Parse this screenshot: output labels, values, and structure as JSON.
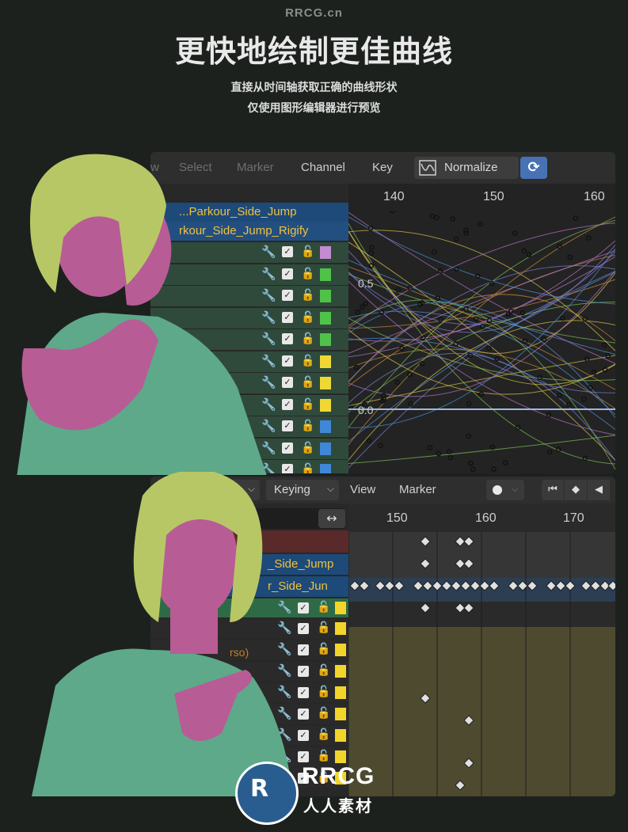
{
  "watermark_top": "RRCG.cn",
  "title": "更快地绘制更佳曲线",
  "subtitle_line1": "直接从时间轴获取正确的曲线形状",
  "subtitle_line2": "仅使用图形编辑器进行预览",
  "graph_editor": {
    "menus": [
      "w",
      "Select",
      "Marker",
      "Channel",
      "Key"
    ],
    "normalize_label": "Normalize",
    "ruler_frames": [
      "140",
      "150",
      "160"
    ],
    "y_labels": [
      "0.5",
      "0.0"
    ],
    "object_rows": [
      "...Parkour_Side_Jump",
      "rkour_Side_Jump_Rigify"
    ],
    "channel_colors": [
      "#c58bd0",
      "#4fc24a",
      "#4fc24a",
      "#4fc24a",
      "#4fc24a",
      "#f0d834",
      "#f0d834",
      "#f0d834",
      "#3f87d8",
      "#3f87d8",
      "#3f87d8"
    ]
  },
  "dope_sheet": {
    "keying_label": "Keying",
    "menus": [
      "View",
      "Marker"
    ],
    "ruler_frames": [
      "150",
      "160",
      "170"
    ],
    "object_rows": [
      "_Side_Jump",
      "r_Side_Jun"
    ],
    "torso_label": "rso)",
    "channel_color": "#f2d52a"
  },
  "logo": {
    "name": "RRCG",
    "cn": "人人素材"
  }
}
